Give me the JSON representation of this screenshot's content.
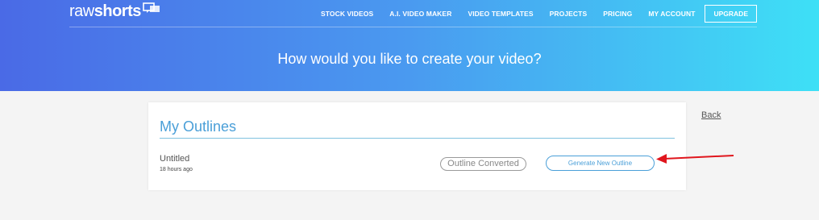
{
  "brand": {
    "logo_raw": "raw",
    "logo_shorts": "shorts",
    "color_accent": "#4a9fd8"
  },
  "nav": {
    "items": [
      "STOCK VIDEOS",
      "A.I. VIDEO MAKER",
      "VIDEO TEMPLATES",
      "PROJECTS",
      "PRICING",
      "MY ACCOUNT"
    ],
    "upgrade_label": "UPGRADE"
  },
  "hero": {
    "title": "How would you like to create your video?"
  },
  "outlines": {
    "title": "My Outlines",
    "items": [
      {
        "name": "Untitled",
        "time": "18 hours ago",
        "status": "Outline Converted"
      }
    ],
    "generate_label": "Generate New Outline"
  },
  "back_label": "Back",
  "annotation": {
    "arrow_color": "#e0161d"
  }
}
